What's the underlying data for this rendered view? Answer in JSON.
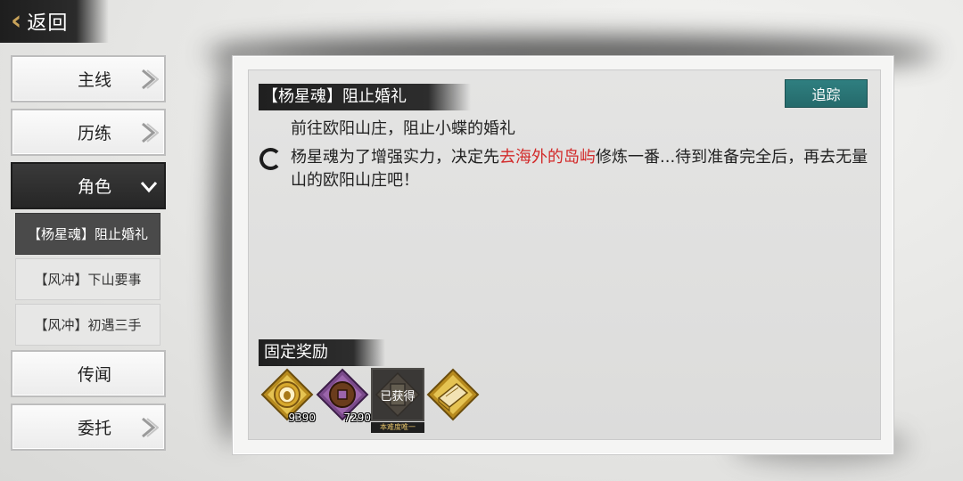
{
  "header": {
    "back_label": "返回"
  },
  "sidebar": {
    "items": [
      {
        "label": "主线"
      },
      {
        "label": "历练"
      },
      {
        "label": "角色"
      },
      {
        "label": "传闻"
      },
      {
        "label": "委托"
      }
    ],
    "sub_items": [
      {
        "label": "【杨星魂】阻止婚礼"
      },
      {
        "label": "【风冲】下山要事"
      },
      {
        "label": "【风冲】初遇三手"
      }
    ]
  },
  "quest": {
    "title": "【杨星魂】阻止婚礼",
    "track_label": "追踪",
    "subtitle": "前往欧阳山庄，阻止小蝶的婚礼",
    "desc_part1": "杨星魂为了增强实力，决定先",
    "desc_highlight": "去海外的岛屿",
    "desc_part2": "修炼一番...待到准备完全后，再去无量山的欧阳山庄吧！"
  },
  "rewards": {
    "heading": "固定奖励",
    "items": [
      {
        "icon": "gold-coin-icon",
        "quantity": "9390"
      },
      {
        "icon": "copper-coin-icon",
        "quantity": "7290"
      },
      {
        "icon": "martial-scroll-icon",
        "status": "已获得",
        "tag": "本难度唯一"
      },
      {
        "icon": "book-icon"
      }
    ]
  },
  "colors": {
    "accent_teal": "#2f7f80",
    "highlight_red": "#d22a2a",
    "gold": "#c9a35a"
  }
}
